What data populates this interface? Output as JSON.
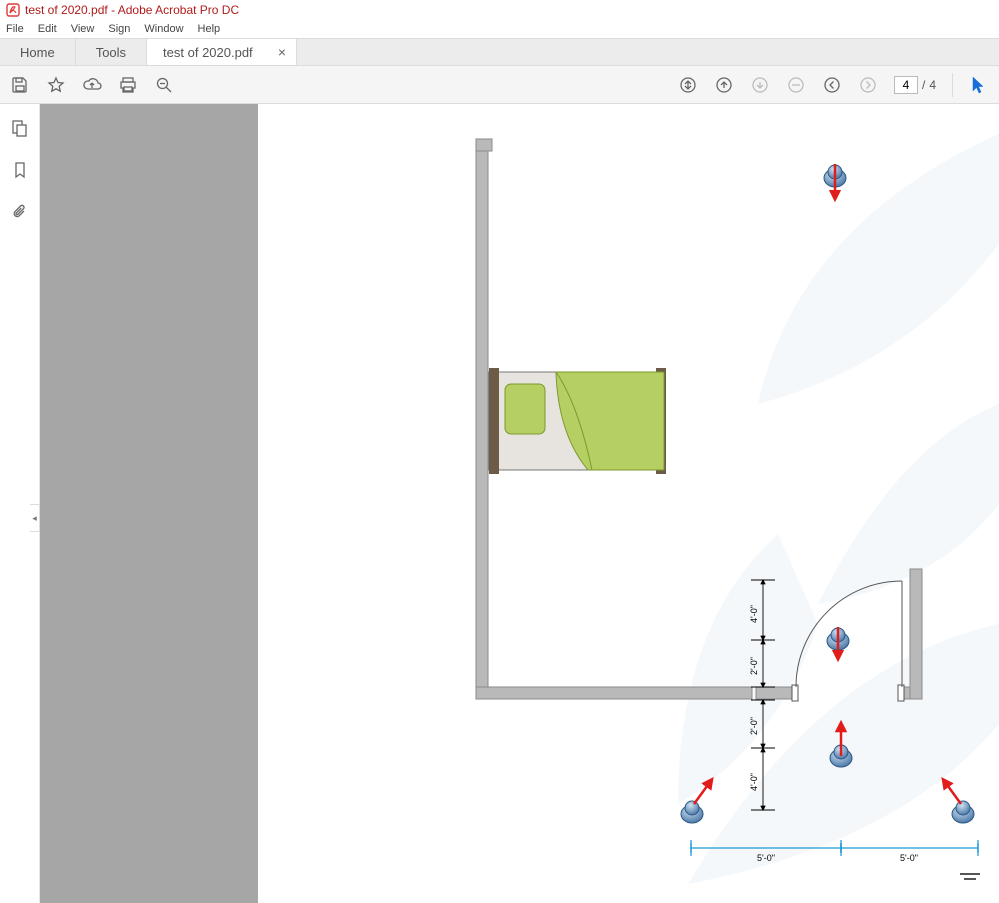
{
  "window": {
    "title": "test of 2020.pdf - Adobe Acrobat Pro DC"
  },
  "menu": {
    "items": [
      "File",
      "Edit",
      "View",
      "Sign",
      "Window",
      "Help"
    ]
  },
  "tabs": {
    "home": "Home",
    "tools": "Tools",
    "file": "test of 2020.pdf"
  },
  "pagenav": {
    "current": "4",
    "total": "4",
    "sep": "/"
  },
  "doc": {
    "dims": {
      "h5a": "5'-0\"",
      "h5b": "5'-0\"",
      "v4a": "4'-0\"",
      "v2a": "2'-0\"",
      "v2b": "2'-0\"",
      "v4b": "4'-0\""
    }
  }
}
